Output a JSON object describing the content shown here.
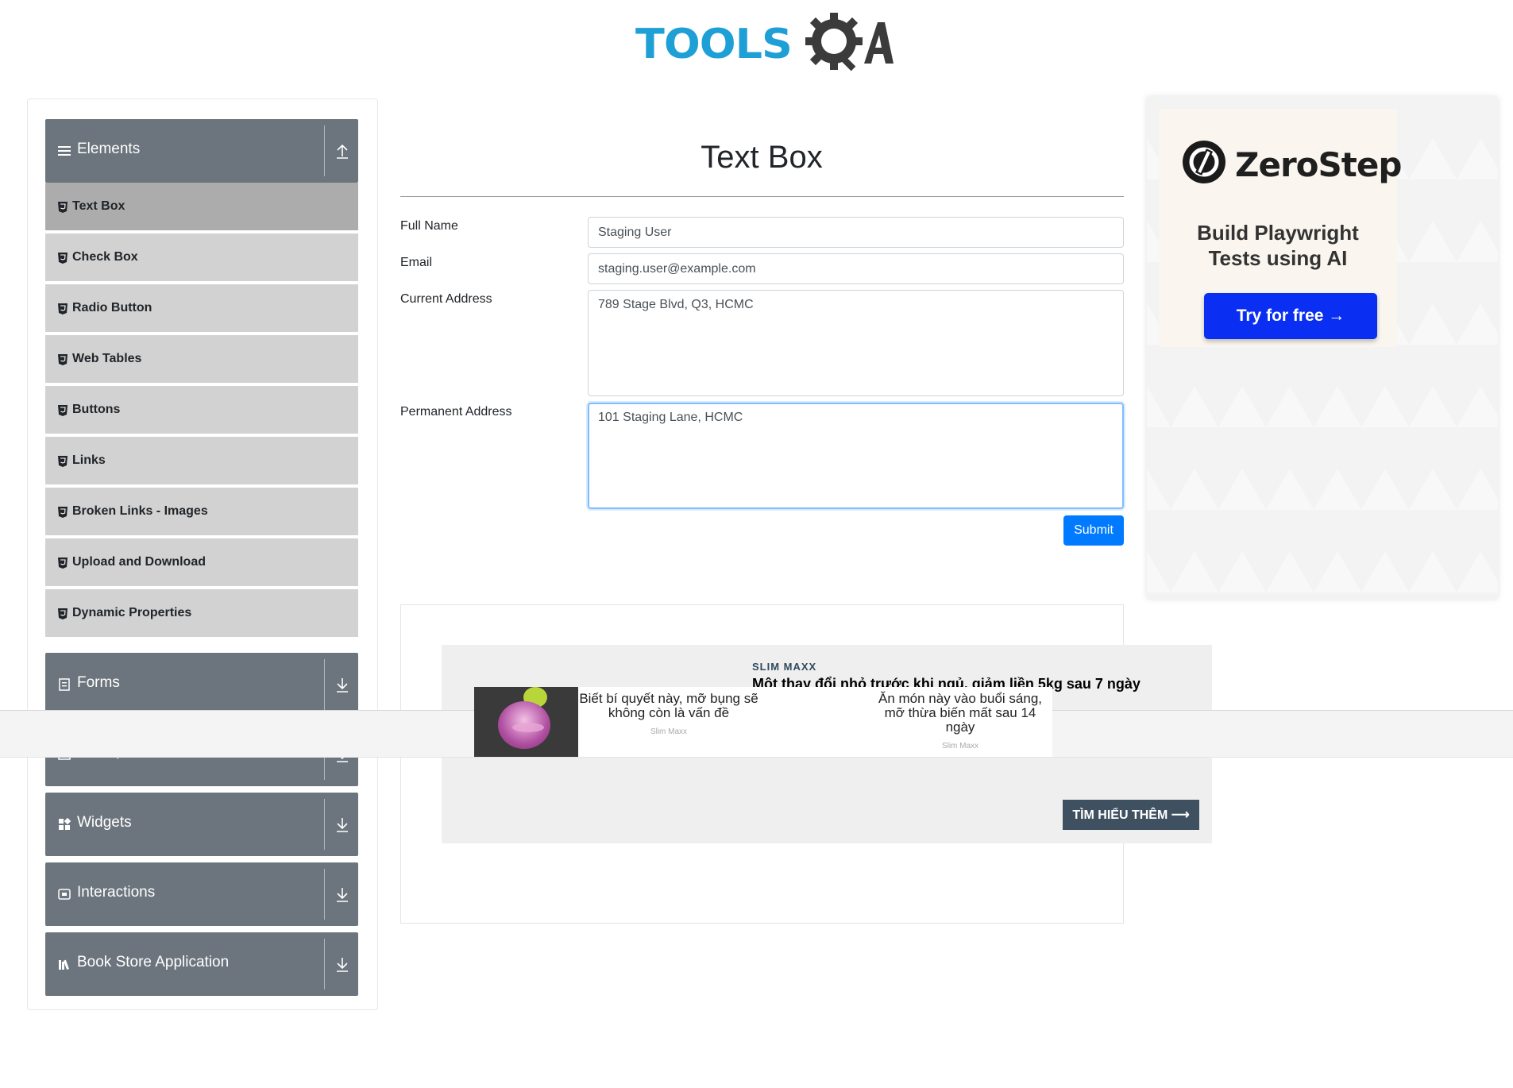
{
  "header": {
    "logo_text": "TOOLS",
    "logo_text_2": "QA",
    "logo_icon": "gear-magnifier-icon"
  },
  "sidebar": {
    "groups": [
      {
        "title": "Elements",
        "icon": "hamburger-icon",
        "arrow": "collapse-up-icon"
      },
      {
        "title": "Forms",
        "icon": "form-icon",
        "arrow": "expand-down-icon"
      },
      {
        "title": "Alerts, Frame & Windows",
        "icon": "window-icon",
        "arrow": "expand-down-icon"
      },
      {
        "title": "Widgets",
        "icon": "widgets-icon",
        "arrow": "expand-down-icon"
      },
      {
        "title": "Interactions",
        "icon": "interactions-icon",
        "arrow": "expand-down-icon"
      },
      {
        "title": "Book Store Application",
        "icon": "books-icon",
        "arrow": "expand-down-icon"
      }
    ],
    "items": [
      {
        "label": "Text Box",
        "active": true
      },
      {
        "label": "Check Box"
      },
      {
        "label": "Radio Button"
      },
      {
        "label": "Web Tables"
      },
      {
        "label": "Buttons"
      },
      {
        "label": "Links"
      },
      {
        "label": "Broken Links - Images"
      },
      {
        "label": "Upload and Download"
      },
      {
        "label": "Dynamic Properties"
      }
    ]
  },
  "main": {
    "title": "Text Box",
    "form": {
      "full_name_label": "Full Name",
      "full_name_value": "Staging User",
      "email_label": "Email",
      "email_value": "staging.user@example.com",
      "current_address_label": "Current Address",
      "current_address_value": "789 Stage Blvd, Q3, HCMC",
      "permanent_address_label": "Permanent Address",
      "permanent_address_value": "101 Staging Lane, HCMC",
      "submit_label": "Submit"
    }
  },
  "native_ad": {
    "sponsor": "SLIM MAXX",
    "headline": "Một thay đổi nhỏ trước khi ngủ, giảm liền 5kg sau 7 ngày",
    "cta": "TÌM HIỂU THÊM ⟶",
    "stories": [
      {
        "text": "Biết bí quyết này, mỡ bụng sẽ không còn là vấn đề",
        "source": "Slim Maxx"
      },
      {
        "text": "Ăn món này vào buổi sáng, mỡ thừa biến mất sau 14 ngày",
        "source": "Slim Maxx"
      }
    ]
  },
  "side_ad": {
    "brand": "ZeroStep",
    "tagline_line1": "Build Playwright",
    "tagline_line2": "Tests using AI",
    "cta": "Try for free →"
  },
  "colors": {
    "sidebar_group": "#6c757d",
    "sidebar_item": "#d2d2d2",
    "sidebar_item_active": "#acacac",
    "primary": "#007bff",
    "logo_blue": "#1e9fd6",
    "ad_button": "#0a2ff2"
  }
}
